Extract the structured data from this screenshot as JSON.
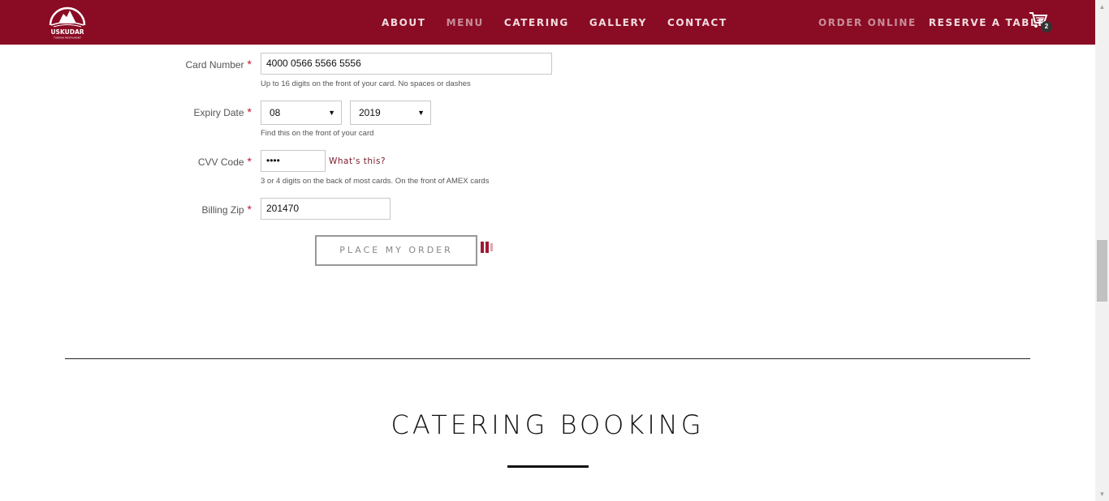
{
  "header": {
    "logo_text": "USKUDAR",
    "logo_subtext": "TURKISH RESTAURANT",
    "nav_main": [
      "ABOUT",
      "MENU",
      "CATERING",
      "GALLERY",
      "CONTACT"
    ],
    "nav_right": [
      "ORDER ONLINE",
      "RESERVE A TABLE"
    ],
    "cart_count": "2",
    "cart_icon": "shopping-cart-icon",
    "brand_color": "#8a0c24"
  },
  "form": {
    "card_number": {
      "label": "Card Number",
      "required_mark": "*",
      "value": "4000 0566 5566 5556",
      "help": "Up to 16 digits on the front of your card. No spaces or dashes"
    },
    "expiry": {
      "label": "Expiry Date",
      "required_mark": "*",
      "month": "08",
      "year": "2019",
      "help": "Find this on the front of your card"
    },
    "cvv": {
      "label": "CVV Code",
      "required_mark": "*",
      "value": "••••",
      "link": "What's this?",
      "help": "3 or 4 digits on the back of most cards. On the front of AMEX cards"
    },
    "billing_zip": {
      "label": "Billing Zip",
      "required_mark": "*",
      "value": "201470"
    },
    "submit_label": "PLACE MY ORDER",
    "loading_icon": "loading-spinner-icon"
  },
  "catering": {
    "title": "CATERING BOOKING"
  }
}
